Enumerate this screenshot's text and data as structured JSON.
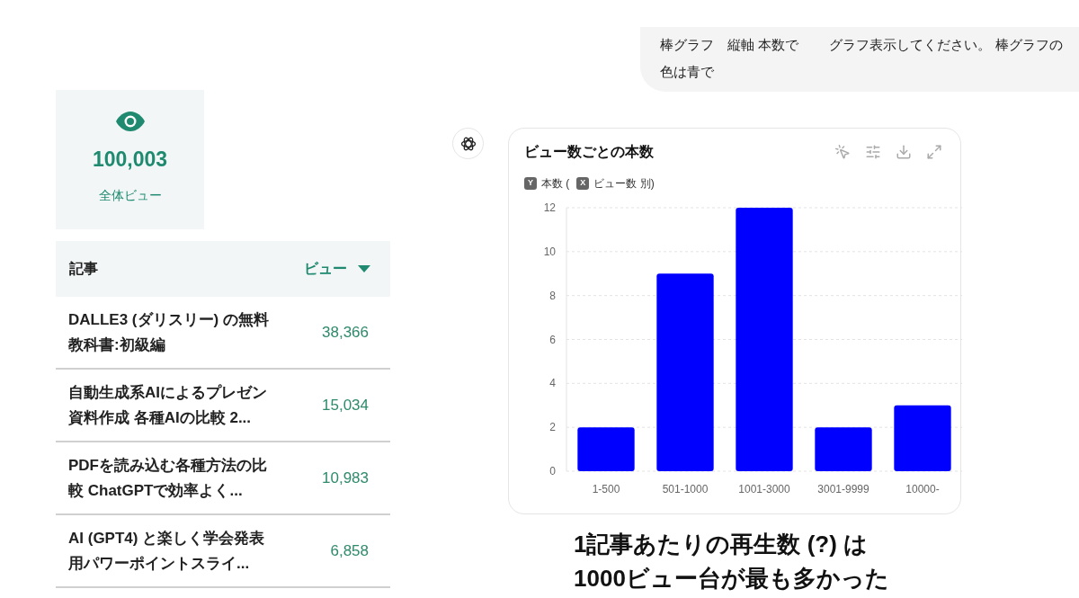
{
  "stats": {
    "total": "100,003",
    "label": "全体ビュー"
  },
  "table": {
    "columns": [
      {
        "label": "記事",
        "sorted": false
      },
      {
        "label": "ビュー",
        "sorted": true
      }
    ],
    "rows": [
      {
        "title": "DALLE3 (ダリスリー) の無料教科書:初級編",
        "views": "38,366"
      },
      {
        "title": "自動生成系AIによるプレゼン資料作成 各種AIの比較 2...",
        "views": "15,034"
      },
      {
        "title": "PDFを読み込む各種方法の比較 ChatGPTで効率よく...",
        "views": "10,983"
      },
      {
        "title": "AI (GPT4) と楽しく学会発表用パワーポイントスライ...",
        "views": "6,858"
      }
    ]
  },
  "user_message": "棒グラフ　縦軸 本数で　　 グラフ表示してください。 棒グラフの色は青で",
  "chart_card": {
    "title": "ビュー数ごとの本数",
    "legend": [
      {
        "key": "Y",
        "label": "本数 ("
      },
      {
        "key": "X",
        "label": "ビュー数 別)"
      }
    ],
    "chart_data": {
      "type": "bar",
      "categories": [
        "1-500",
        "501-1000",
        "1001-3000",
        "3001-9999",
        "10000-"
      ],
      "series": [
        {
          "color": "#0000ff",
          "values": [
            2,
            9,
            12,
            2,
            3
          ]
        }
      ],
      "grid": true,
      "ylim": [
        0,
        12
      ],
      "yticks": [
        0,
        2,
        4,
        6,
        8,
        10,
        12
      ]
    }
  },
  "caption": [
    "1記事あたりの再生数 (?) は",
    "1000ビュー台が最も多かった"
  ]
}
